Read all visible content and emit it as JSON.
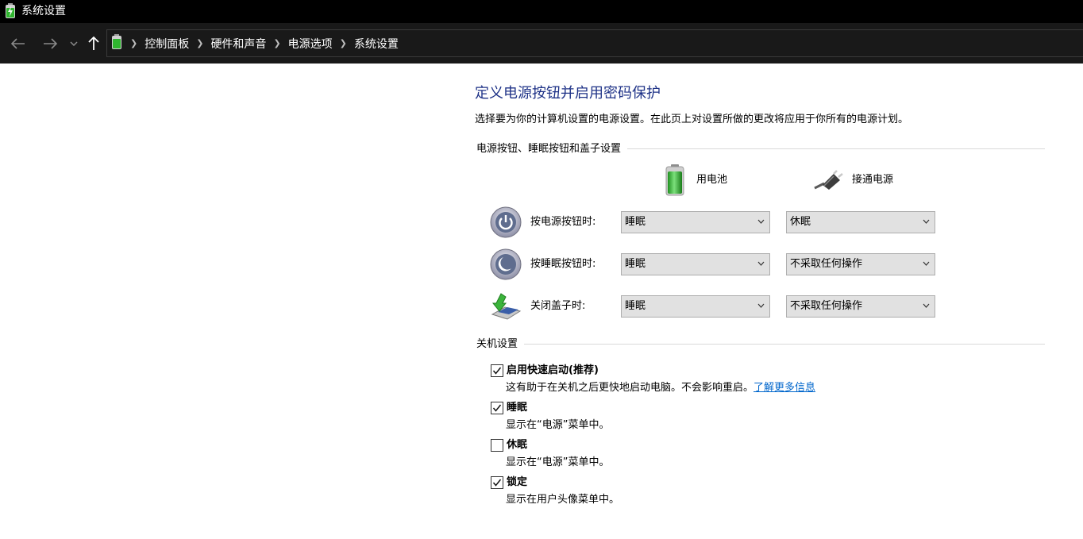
{
  "window": {
    "title": "系统设置"
  },
  "nav": {
    "back_icon": "arrow-left-icon",
    "forward_icon": "arrow-right-icon",
    "recent_icon": "chevron-down-icon",
    "up_icon": "arrow-up-icon",
    "breadcrumbs": [
      "控制面板",
      "硬件和声音",
      "电源选项",
      "系统设置"
    ]
  },
  "page": {
    "heading": "定义电源按钮并启用密码保护",
    "subtitle": "选择要为你的计算机设置的电源设置。在此页上对设置所做的更改将应用于你所有的电源计划。"
  },
  "buttons_section": {
    "label": "电源按钮、睡眠按钮和盖子设置",
    "col_battery": "用电池",
    "col_plugged": "接通电源",
    "rows": [
      {
        "label": "按电源按钮时:",
        "icon": "power-button-icon",
        "battery": "睡眠",
        "plugged": "休眠"
      },
      {
        "label": "按睡眠按钮时:",
        "icon": "sleep-button-icon",
        "battery": "睡眠",
        "plugged": "不采取任何操作"
      },
      {
        "label": "关闭盖子时:",
        "icon": "laptop-lid-icon",
        "battery": "睡眠",
        "plugged": "不采取任何操作"
      }
    ]
  },
  "shutdown_section": {
    "label": "关机设置",
    "items": [
      {
        "label": "启用快速启动(推荐)",
        "checked": true,
        "desc": "这有助于在关机之后更快地启动电脑。不会影响重启。",
        "link": "了解更多信息"
      },
      {
        "label": "睡眠",
        "checked": true,
        "desc": "显示在“电源”菜单中。"
      },
      {
        "label": "休眠",
        "checked": false,
        "desc": "显示在“电源”菜单中。"
      },
      {
        "label": "锁定",
        "checked": true,
        "desc": "显示在用户头像菜单中。"
      }
    ]
  },
  "colors": {
    "heading": "#1e3287",
    "link": "#0066cc",
    "titlebar": "#000000",
    "navbar": "#191919"
  }
}
